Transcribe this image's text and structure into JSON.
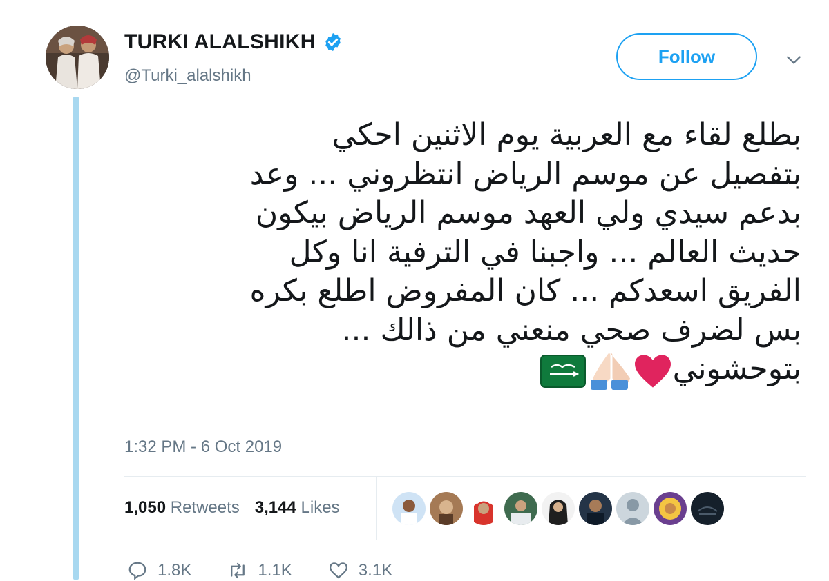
{
  "author": {
    "display_name": "TURKI ALALSHIKH",
    "handle": "@Turki_alalshikh",
    "avatar_icon": "profile-photo"
  },
  "follow_label": "Follow",
  "tweet": {
    "lines": [
      "بطلع لقاء مع العربية يوم الاثنين احكي",
      "بتفصيل عن موسم الرياض انتظروني ... وعد",
      "بدعم سيدي ولي العهد موسم الرياض بيكون",
      "حديث العالم ... واجبنا في الترفية انا وكل",
      "الفريق اسعدكم ... كان المفروض اطلع بكره",
      "بس لضرف صحي منعني من ذالك ...",
      "بتوحشوني"
    ],
    "emojis": [
      "red-heart-icon",
      "folded-hands-icon",
      "saudi-flag-icon"
    ],
    "timestamp": "1:32 PM - 6 Oct 2019"
  },
  "stats": {
    "retweets_count": "1,050",
    "retweets_label": "Retweets",
    "likes_count": "3,144",
    "likes_label": "Likes"
  },
  "actions": {
    "replies": "1.8K",
    "retweets": "1.1K",
    "likes": "3.1K"
  },
  "colors": {
    "accent": "#1da1f2",
    "verified": "#1da1f2",
    "thread_line": "#a8d8f0",
    "muted_text": "#657786",
    "heart": "#e0245e",
    "flag_green": "#0f7a3c"
  }
}
